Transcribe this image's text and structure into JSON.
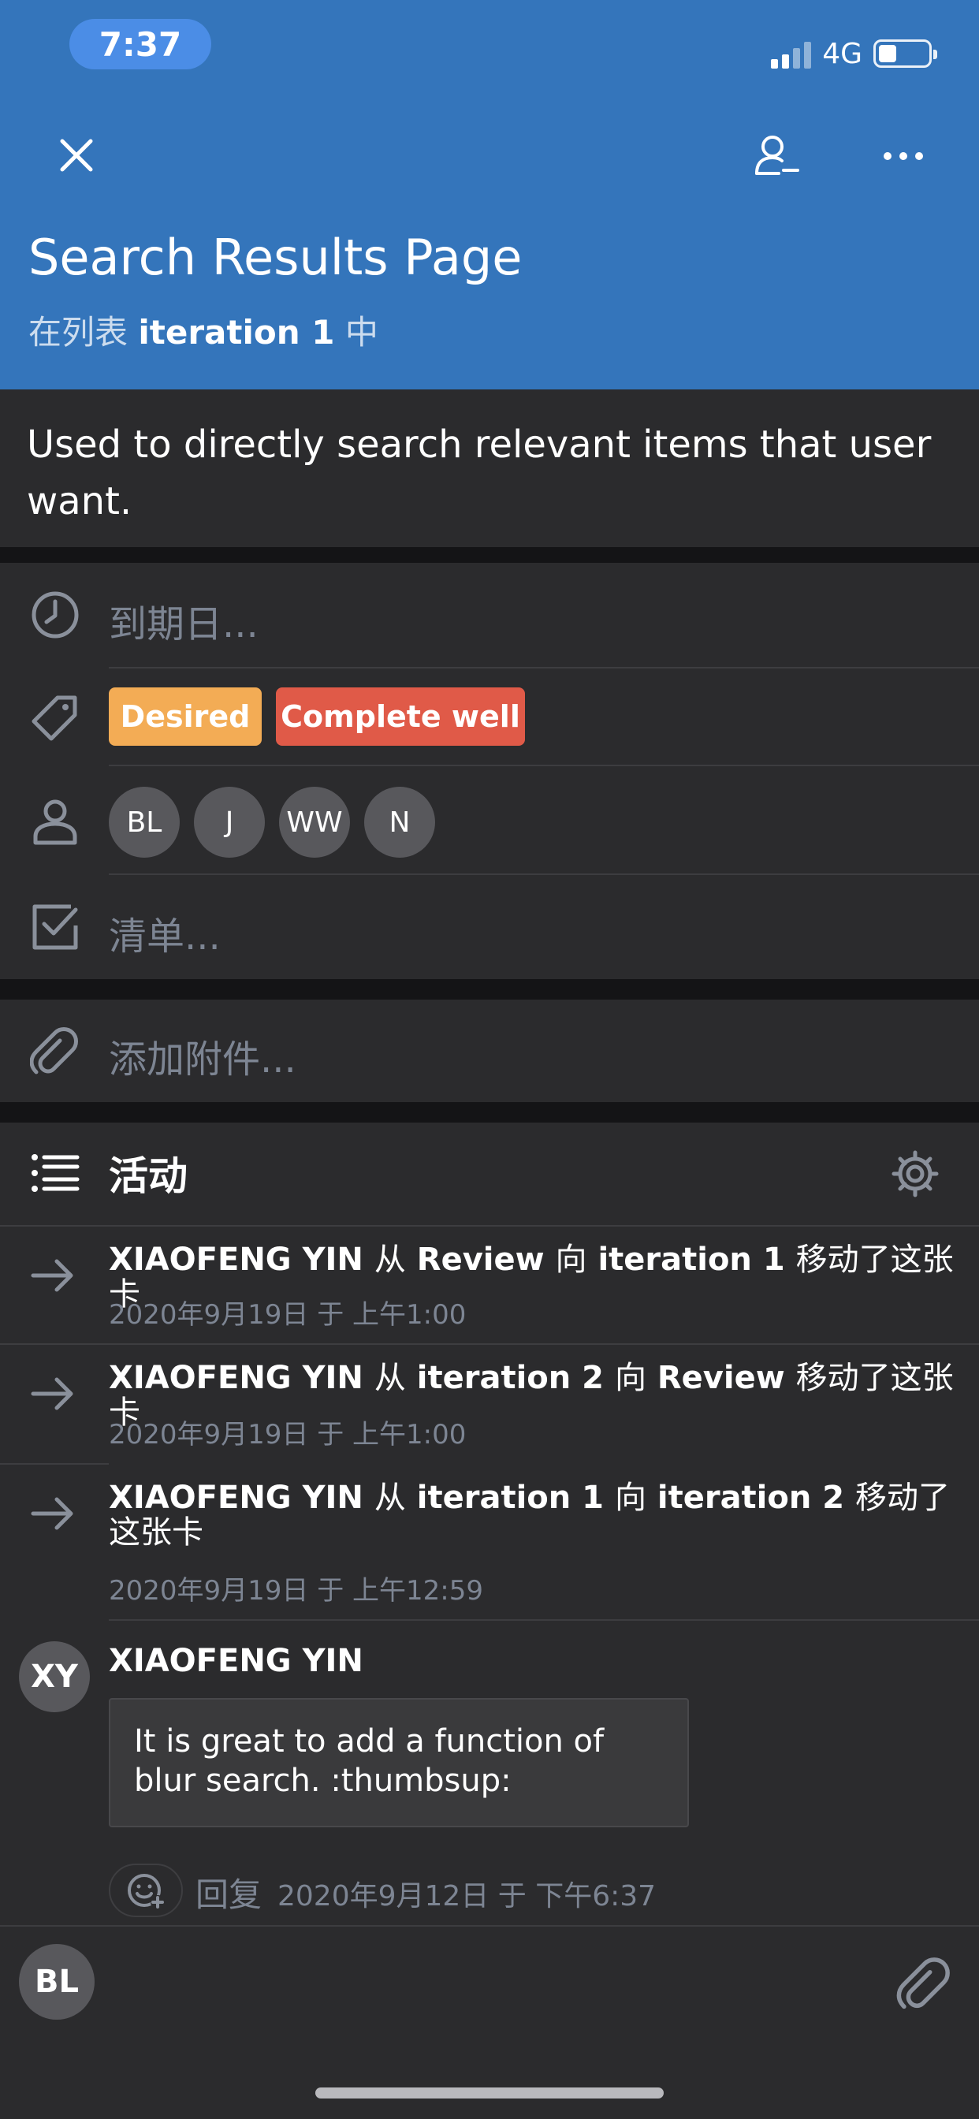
{
  "status_bar": {
    "time": "7:37",
    "network": "4G",
    "battery_level": 0.36
  },
  "header": {
    "card_title": "Search Results Page",
    "list_prefix": "在列表",
    "list_name": "iteration 1",
    "list_suffix": "中",
    "icons": [
      "close-icon",
      "member-icon",
      "more-icon"
    ]
  },
  "description": "Used to directly search relevant items that user want.",
  "fields": {
    "due_date_placeholder": "到期日...",
    "labels": [
      {
        "text": "Desired",
        "color": "#f3ac55"
      },
      {
        "text": "Complete well",
        "color": "#e05a48"
      }
    ],
    "members": [
      "BL",
      "J",
      "WW",
      "N"
    ],
    "checklist_placeholder": "清单...",
    "attachment_placeholder": "添加附件..."
  },
  "activity": {
    "title": "活动",
    "items": [
      {
        "user": "XIAOFENG YIN",
        "w1": "从",
        "from": "Review",
        "w2": "向",
        "to": "iteration 1",
        "w3": "移动了这张卡",
        "date": "2020年9月19日 于 上午1:00"
      },
      {
        "user": "XIAOFENG YIN",
        "w1": "从",
        "from": "iteration 2",
        "w2": "向",
        "to": "Review",
        "w3": "移动了这张卡",
        "date": "2020年9月19日 于 上午1:00"
      },
      {
        "user": "XIAOFENG YIN",
        "w1": "从",
        "from": "iteration 1",
        "w2": "向",
        "to": "iteration 2",
        "w3": "移动了这张卡",
        "date": "2020年9月19日 于 上午12:59"
      }
    ],
    "comment": {
      "initials": "XY",
      "author": "XIAOFENG YIN",
      "text": "It is great to add a function of blur search. :thumbsup:",
      "reply_label": "回复",
      "date": "2020年9月12日 于 下午6:37"
    }
  },
  "composer": {
    "initials": "BL"
  }
}
